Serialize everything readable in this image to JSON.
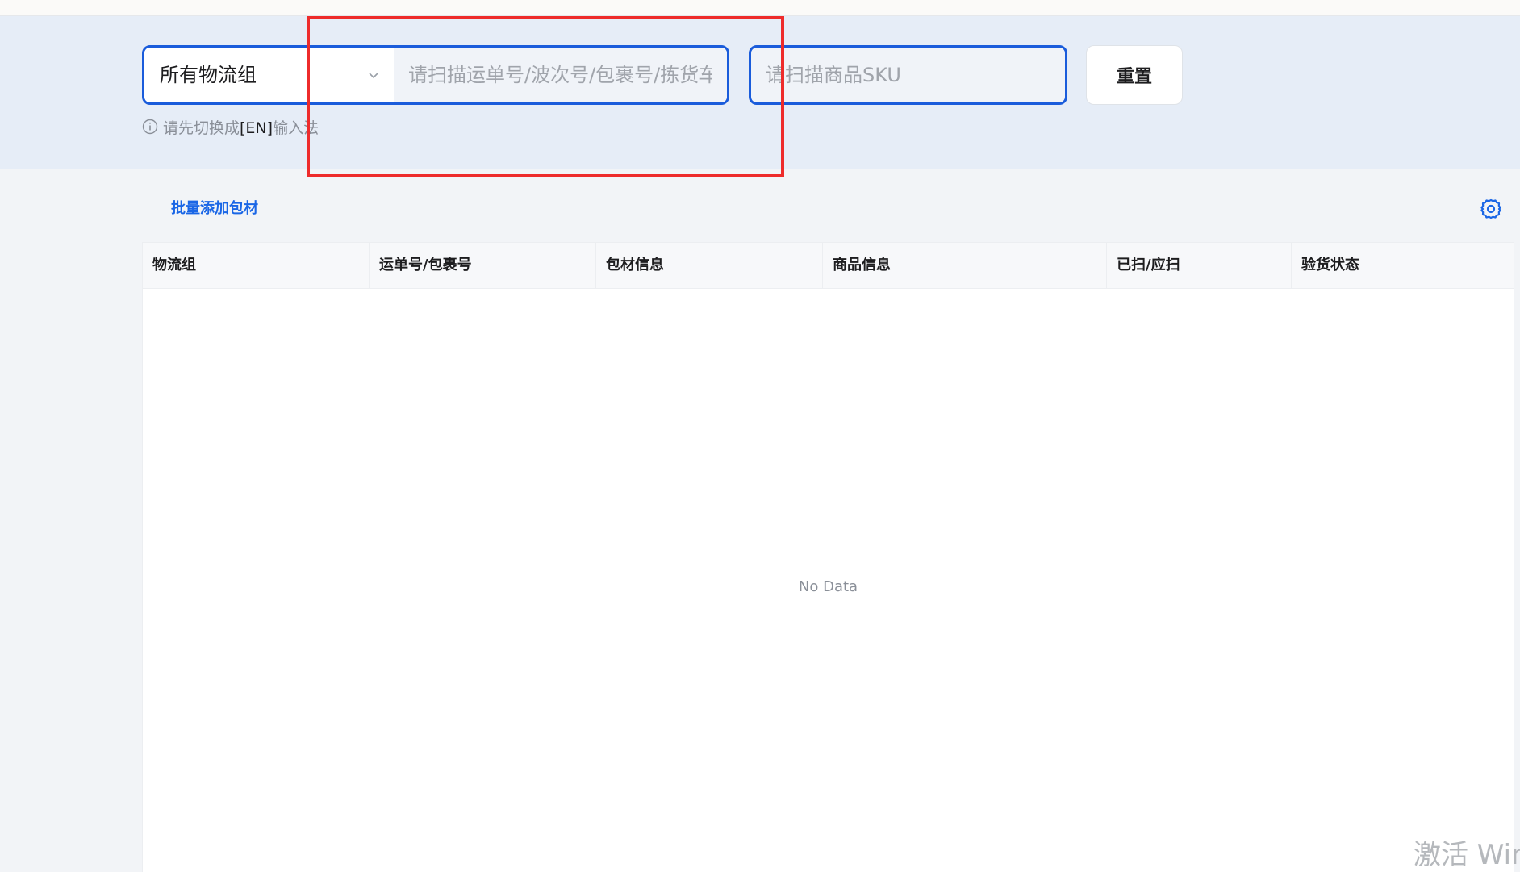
{
  "scan": {
    "group_select_value": "所有物流组",
    "waybill_placeholder": "请扫描运单号/波次号/包裹号/拣货车",
    "sku_placeholder": "请扫描商品SKU",
    "reset_label": "重置",
    "hint_prefix": "请先切换成",
    "hint_em": "[EN]",
    "hint_suffix": "输入法"
  },
  "toolbar": {
    "batch_add_label": "批量添加包材"
  },
  "table": {
    "columns": [
      "物流组",
      "运单号/包裹号",
      "包材信息",
      "商品信息",
      "已扫/应扫",
      "验货状态"
    ],
    "empty_text": "No Data"
  },
  "watermark": {
    "text": "激活 Wind"
  },
  "colors": {
    "accent": "#1a5cdb",
    "highlight": "#ee2b2b",
    "link": "#1a66e6"
  }
}
